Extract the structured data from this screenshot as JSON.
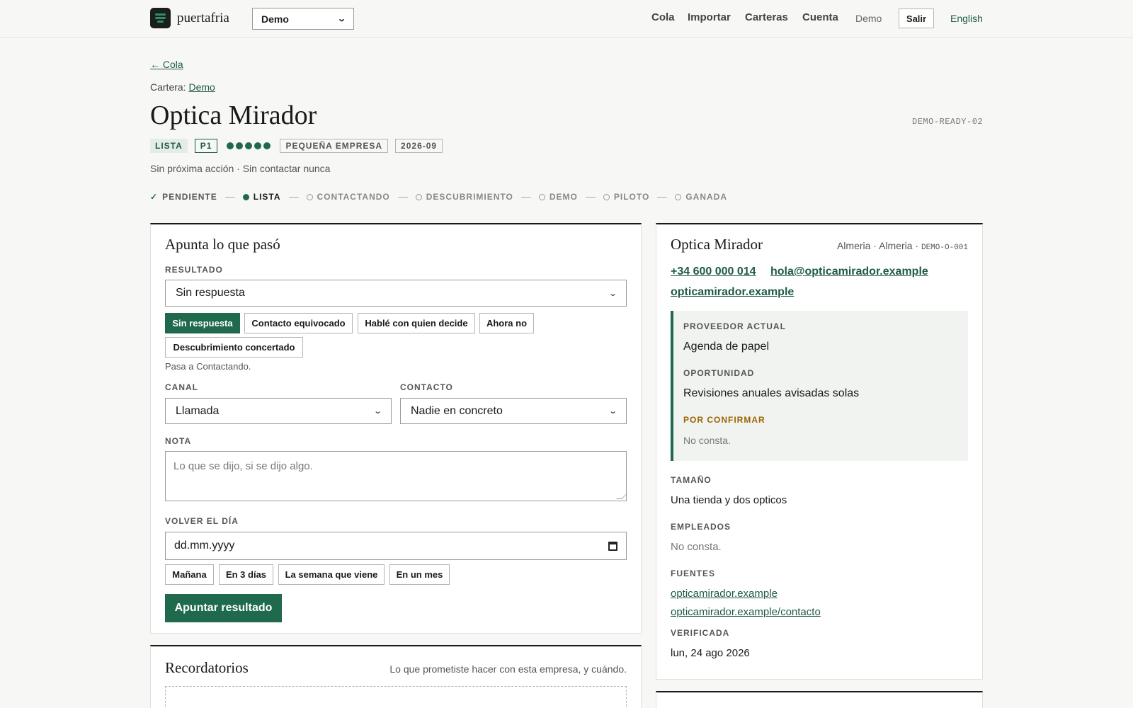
{
  "header": {
    "brand": "puertafria",
    "portfolio_select": "Demo",
    "nav": [
      "Cola",
      "Importar",
      "Carteras",
      "Cuenta"
    ],
    "user": "Demo",
    "logout": "Salir",
    "language": "English"
  },
  "page": {
    "back_link": "← Cola",
    "portfolio_label": "Cartera:",
    "portfolio_link": "Demo",
    "title": "Optica Mirador",
    "ref_code": "DEMO-READY-02",
    "badges": {
      "status": "LISTA",
      "priority": "P1",
      "score_dots": 5,
      "segment": "PEQUEÑA EMPRESA",
      "period": "2026-09"
    },
    "subline": "Sin próxima acción · Sin contactar nunca",
    "stages": [
      {
        "label": "PENDIENTE",
        "state": "done"
      },
      {
        "label": "LISTA",
        "state": "current"
      },
      {
        "label": "CONTACTANDO",
        "state": "todo"
      },
      {
        "label": "DESCUBRIMIENTO",
        "state": "todo"
      },
      {
        "label": "DEMO",
        "state": "todo"
      },
      {
        "label": "PILOTO",
        "state": "todo"
      },
      {
        "label": "GANADA",
        "state": "todo"
      }
    ]
  },
  "form": {
    "title": "Apunta lo que pasó",
    "result_label": "RESULTADO",
    "result_value": "Sin respuesta",
    "result_chips": [
      "Sin respuesta",
      "Contacto equivocado",
      "Hablé con quien decide",
      "Ahora no",
      "Descubrimiento concertado"
    ],
    "result_active": "Sin respuesta",
    "result_hint": "Pasa a Contactando.",
    "channel_label": "CANAL",
    "channel_value": "Llamada",
    "contact_label": "CONTACTO",
    "contact_value": "Nadie en concreto",
    "note_label": "NOTA",
    "note_placeholder": "Lo que se dijo, si se dijo algo.",
    "return_label": "VOLVER EL DÍA",
    "return_placeholder": "dd.mm.yyyy",
    "date_chips": [
      "Mañana",
      "En 3 días",
      "La semana que viene",
      "En un mes"
    ],
    "submit": "Apuntar resultado"
  },
  "reminders": {
    "title": "Recordatorios",
    "note": "Lo que prometiste hacer con esta empresa, y cuándo."
  },
  "company": {
    "name": "Optica Mirador",
    "location": "Almeria · Almeria ·",
    "code": "DEMO-O-001",
    "phone": "+34 600 000 014",
    "email": "hola@opticamirador.example",
    "website": "opticamirador.example",
    "provider_label": "PROVEEDOR ACTUAL",
    "provider_value": "Agenda de papel",
    "opportunity_label": "OPORTUNIDAD",
    "opportunity_value": "Revisiones anuales avisadas solas",
    "pending_label": "POR CONFIRMAR",
    "pending_value": "No consta.",
    "size_label": "TAMAÑO",
    "size_value": "Una tienda y dos opticos",
    "employees_label": "EMPLEADOS",
    "employees_value": "No consta.",
    "sources_label": "FUENTES",
    "sources": [
      "opticamirador.example",
      "opticamirador.example/contacto"
    ],
    "verified_label": "VERIFICADA",
    "verified_value": "lun, 24 ago 2026"
  },
  "colors": {
    "accent": "#1f6a4d",
    "link": "#1f5a44",
    "warning": "#9a6400",
    "background": "#f7f7f5"
  }
}
